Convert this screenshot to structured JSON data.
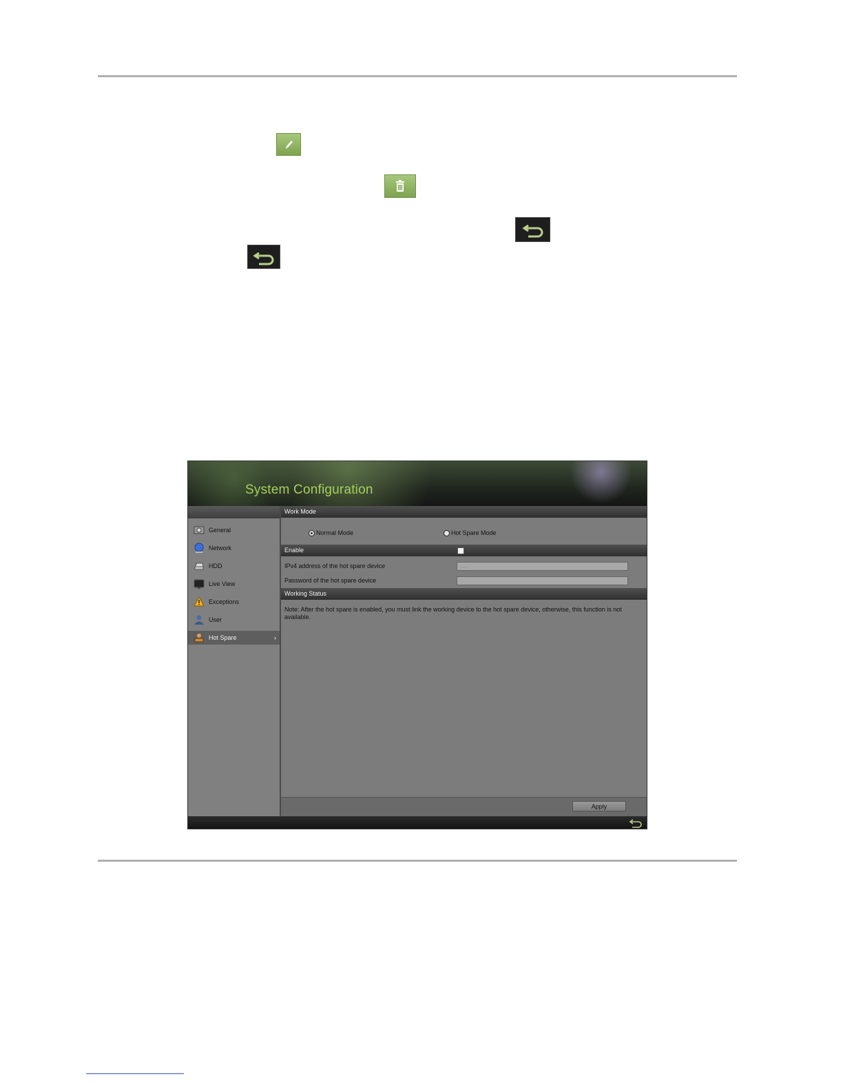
{
  "window": {
    "title": "System Configuration"
  },
  "sidebar": {
    "items": [
      {
        "label": "General",
        "icon": "general-icon"
      },
      {
        "label": "Network",
        "icon": "network-icon"
      },
      {
        "label": "HDD",
        "icon": "hdd-icon"
      },
      {
        "label": "Live View",
        "icon": "live-view-icon"
      },
      {
        "label": "Exceptions",
        "icon": "warning-icon"
      },
      {
        "label": "User",
        "icon": "user-icon"
      },
      {
        "label": "Hot Spare",
        "icon": "hot-spare-icon",
        "active": true,
        "arrow": "›"
      }
    ]
  },
  "main": {
    "work_mode": {
      "header": "Work Mode",
      "options": [
        {
          "label": "Normal Mode",
          "selected": true
        },
        {
          "label": "Hot Spare Mode",
          "selected": false
        }
      ]
    },
    "enable": {
      "header": "Enable",
      "checked": false
    },
    "fields": [
      {
        "label": "IPv4 address of the hot spare device",
        "value": ". . ."
      },
      {
        "label": "Password of the hot spare device",
        "value": ""
      }
    ],
    "working_status": {
      "header": "Working Status",
      "note": "Note: After the hot spare is enabled, you must link the working device to the hot spare device, otherwise, this function is not available."
    },
    "apply_label": "Apply"
  },
  "doc_icons": [
    "edit-icon",
    "delete-icon",
    "back-icon",
    "back-icon"
  ],
  "colors": {
    "title_green": "#a6d05a",
    "panel_gray": "#7c7c7c",
    "section_bar": "#3a3a3a",
    "active_item": "#5e5e5e"
  }
}
